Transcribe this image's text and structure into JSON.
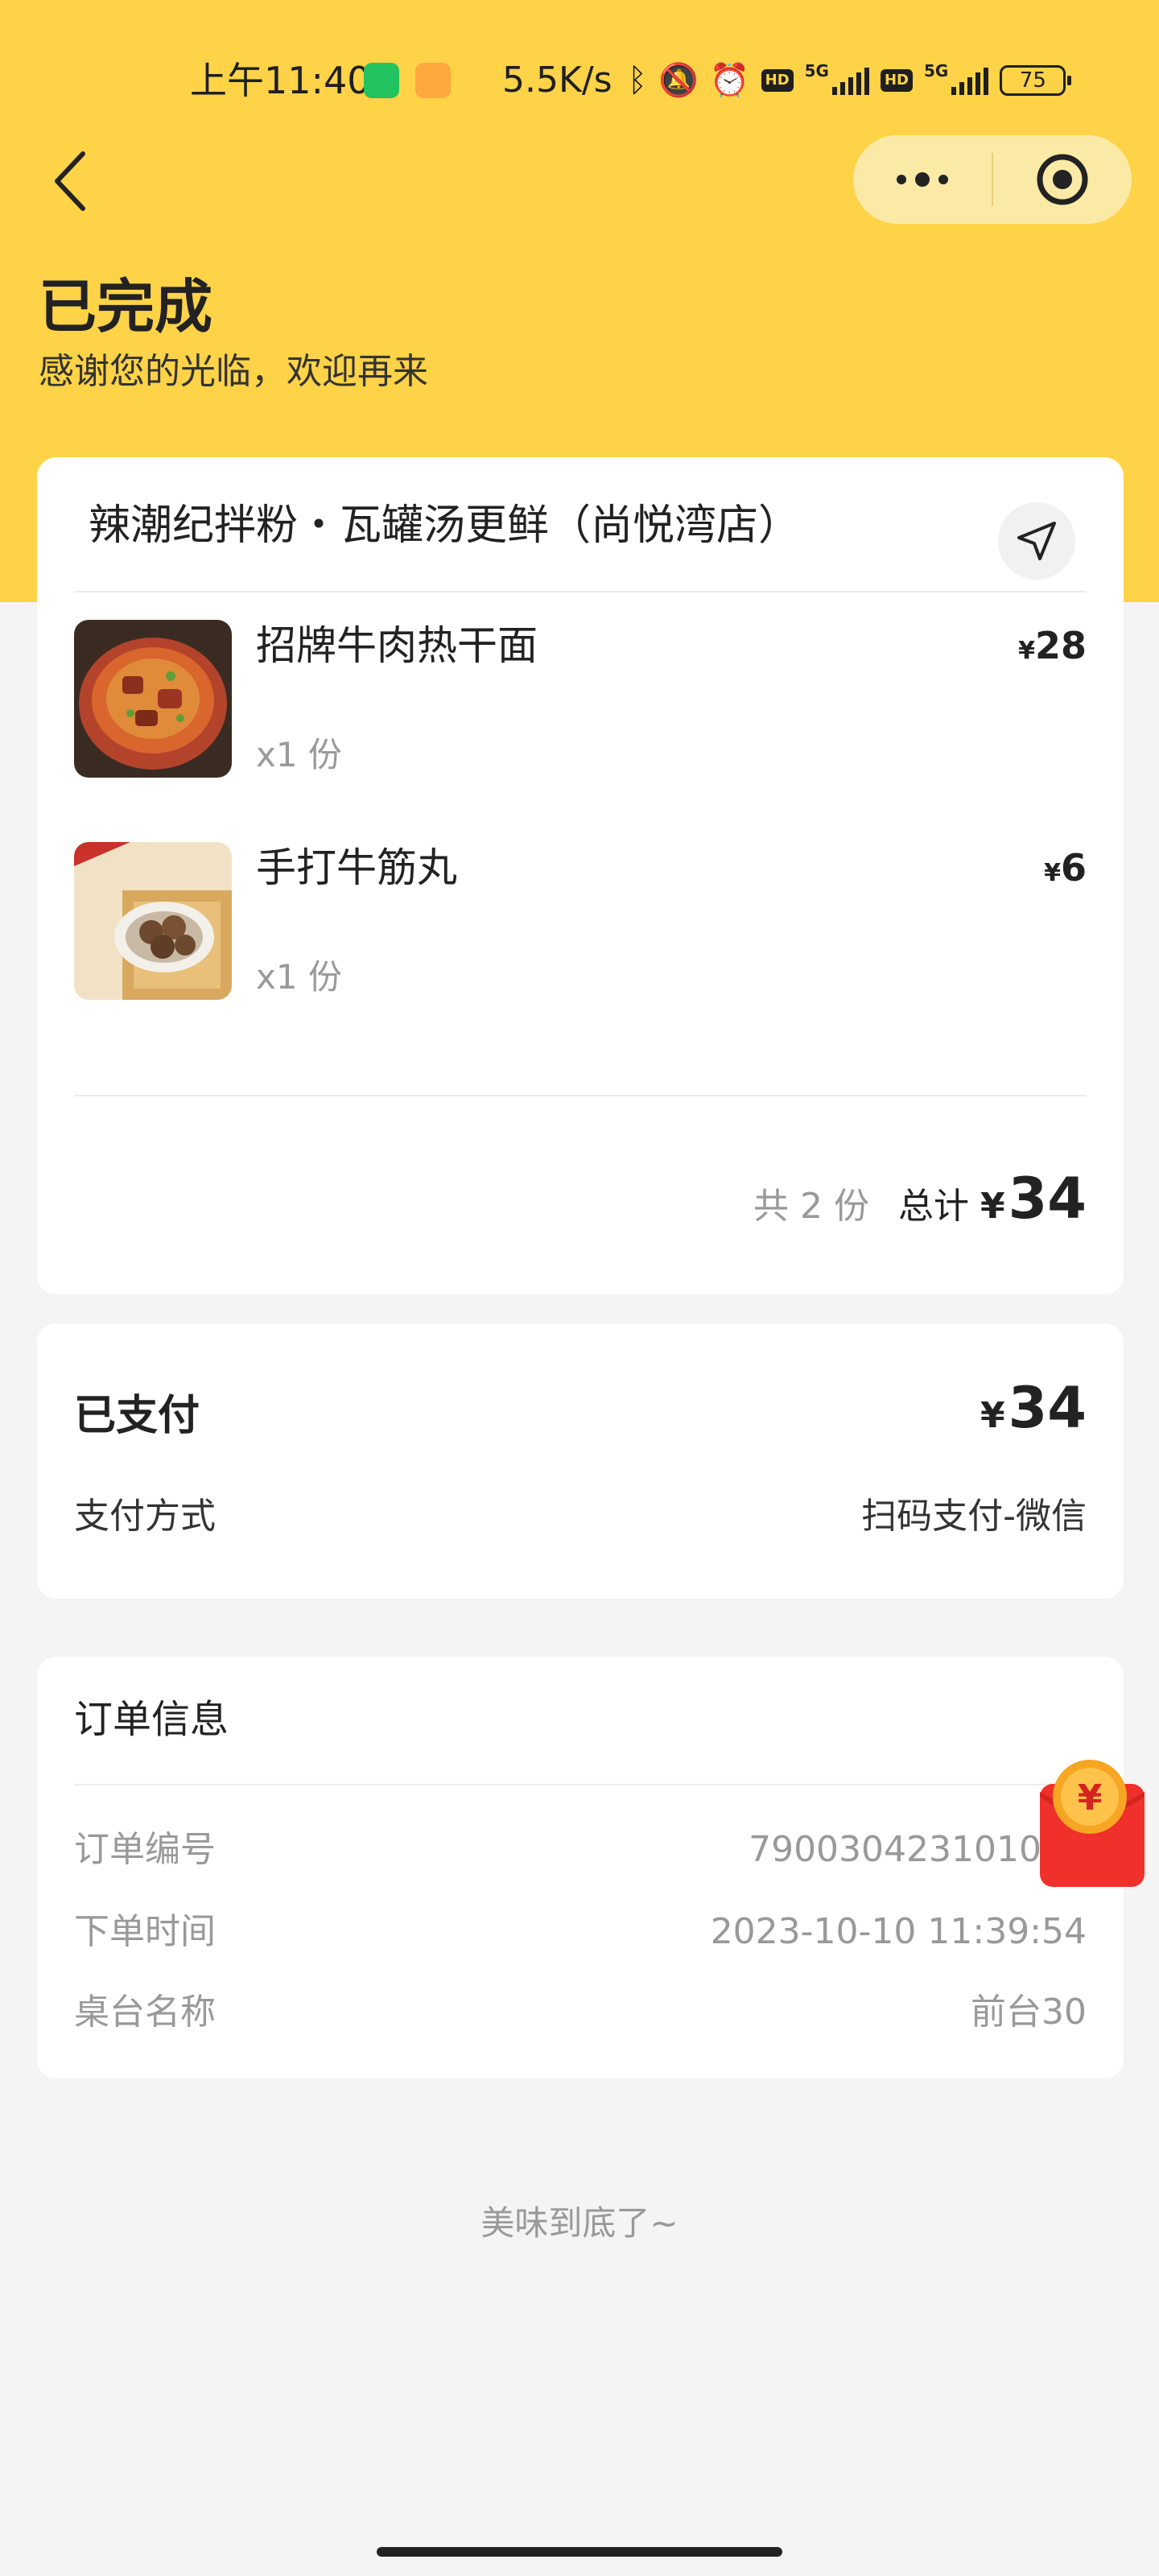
{
  "status_bar": {
    "time": "上午11:40",
    "speed": "5.5K/s",
    "network_1": "5G",
    "network_2": "5G",
    "hd_1": "HD",
    "hd_2": "HD",
    "battery": "75"
  },
  "header": {
    "title": "已完成",
    "subtitle": "感谢您的光临，欢迎再来"
  },
  "order": {
    "store_name": "辣潮纪拌粉・瓦罐汤更鲜（尚悦湾店）",
    "currency": "¥",
    "items": [
      {
        "name": "招牌牛肉热干面",
        "qty": "x1 份",
        "price": "28"
      },
      {
        "name": "手打牛筋丸",
        "qty": "x1 份",
        "price": "6"
      }
    ],
    "count_text": "共 2 份",
    "total_label": "总计",
    "total": "34"
  },
  "payment": {
    "status": "已支付",
    "amount": "34",
    "method_label": "支付方式",
    "method_value": "扫码支付-微信"
  },
  "info": {
    "title": "订单信息",
    "rows": [
      {
        "label": "订单编号",
        "value": "790030423101000"
      },
      {
        "label": "下单时间",
        "value": "2023-10-10 11:39:54"
      },
      {
        "label": "桌台名称",
        "value": "前台30"
      }
    ]
  },
  "promo": {
    "badge": "¥"
  },
  "footer": {
    "text": "美味到底了~"
  },
  "colors": {
    "brand_yellow": "#ffd348",
    "capsule": "#fbe9a6",
    "red_packet": "#f0302a"
  }
}
